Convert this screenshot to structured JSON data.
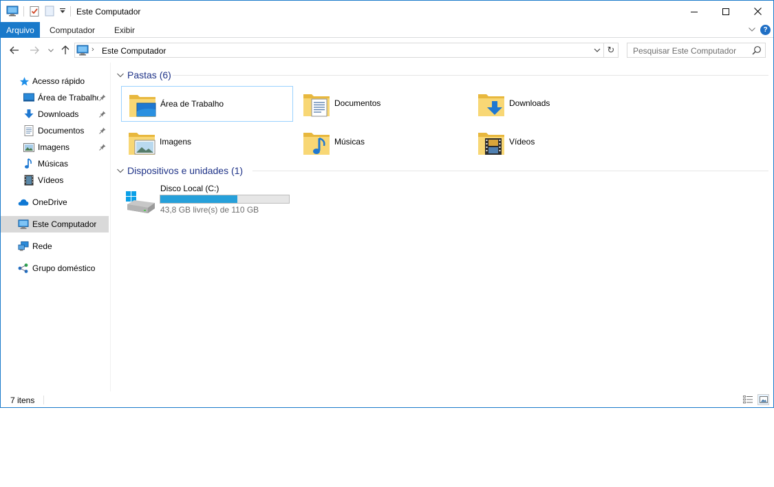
{
  "window": {
    "title": "Este Computador"
  },
  "ribbon": {
    "tabs": [
      "Arquivo",
      "Computador",
      "Exibir"
    ],
    "help_glyph": "?"
  },
  "address": {
    "path": "Este Computador",
    "separator": "›",
    "refresh_glyph": "↻",
    "search_placeholder": "Pesquisar Este Computador"
  },
  "sidebar": {
    "items": [
      {
        "label": "Acesso rápido",
        "icon": "star-icon"
      },
      {
        "label": "Área de Trabalho",
        "icon": "desktop-icon",
        "pinned": true
      },
      {
        "label": "Downloads",
        "icon": "downloads-icon",
        "pinned": true
      },
      {
        "label": "Documentos",
        "icon": "documents-icon",
        "pinned": true
      },
      {
        "label": "Imagens",
        "icon": "pictures-icon",
        "pinned": true
      },
      {
        "label": "Músicas",
        "icon": "music-icon"
      },
      {
        "label": "Vídeos",
        "icon": "videos-icon"
      },
      {
        "label": "OneDrive",
        "icon": "onedrive-icon"
      },
      {
        "label": "Este Computador",
        "icon": "computer-icon",
        "selected": true
      },
      {
        "label": "Rede",
        "icon": "network-icon"
      },
      {
        "label": "Grupo doméstico",
        "icon": "homegroup-icon"
      }
    ]
  },
  "content": {
    "folders_header": "Pastas (6)",
    "folders": [
      {
        "label": "Área de Trabalho",
        "icon": "desktop-folder-icon"
      },
      {
        "label": "Documentos",
        "icon": "documents-folder-icon"
      },
      {
        "label": "Downloads",
        "icon": "downloads-folder-icon"
      },
      {
        "label": "Imagens",
        "icon": "pictures-folder-icon"
      },
      {
        "label": "Músicas",
        "icon": "music-folder-icon"
      },
      {
        "label": "Vídeos",
        "icon": "videos-folder-icon"
      }
    ],
    "devices_header": "Dispositivos e unidades (1)",
    "drive": {
      "name": "Disco Local (C:)",
      "free_text": "43,8 GB livre(s) de 110 GB",
      "used_fraction": 0.6
    }
  },
  "status": {
    "item_count": "7 itens"
  },
  "colors": {
    "accent": "#1979ca",
    "group_title": "#1e3287",
    "drive_bar": "#26a0da",
    "folder": "#f8d775"
  }
}
